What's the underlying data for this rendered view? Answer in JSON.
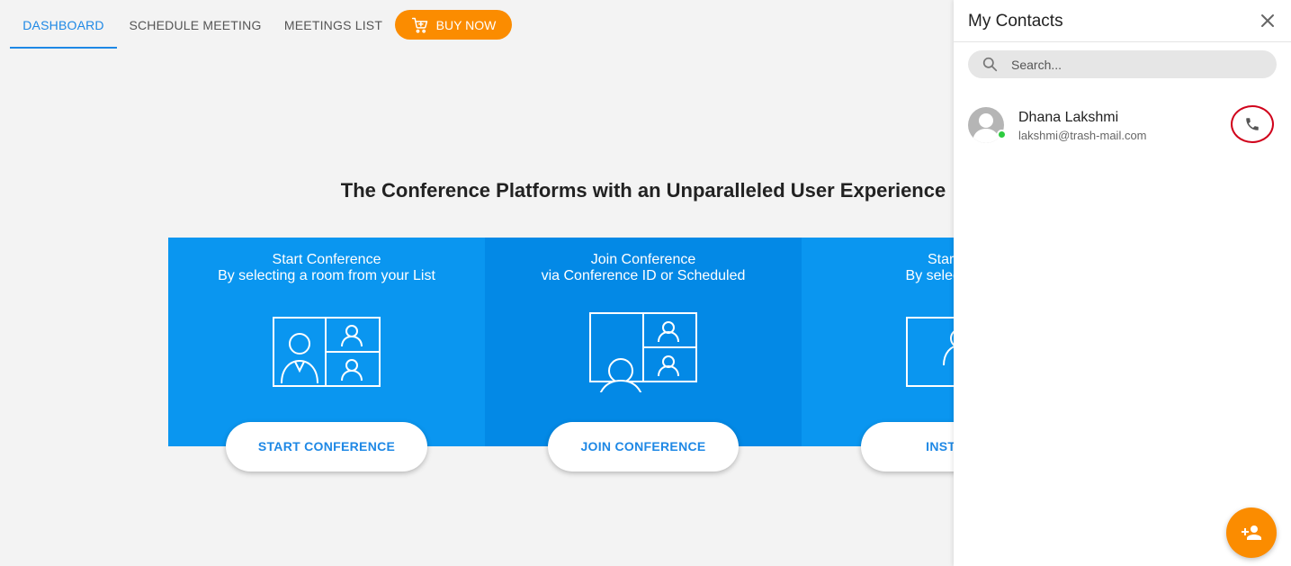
{
  "nav": {
    "tabs": [
      {
        "label": "DASHBOARD",
        "active": true
      },
      {
        "label": "SCHEDULE MEETING",
        "active": false
      },
      {
        "label": "MEETINGS LIST",
        "active": false
      }
    ],
    "buy_label": "BUY NOW",
    "buy_icon": "cart-icon"
  },
  "main": {
    "headline": "The Conference Platforms with an Unparalleled User Experience",
    "cards": [
      {
        "title_line1": "Start Conference",
        "title_line2": "By selecting a room from your List",
        "button": "START CONFERENCE"
      },
      {
        "title_line1": "Join Conference",
        "title_line2": "via Conference ID or Scheduled",
        "button": "JOIN CONFERENCE"
      },
      {
        "title_line1": "Start Conf",
        "title_line2": "By selecting a co",
        "button": "INSTA CO"
      }
    ]
  },
  "contacts": {
    "title": "My Contacts",
    "search_placeholder": "Search...",
    "items": [
      {
        "name": "Dhana Lakshmi",
        "email": "lakshmi@trash-mail.com",
        "status": "online"
      }
    ]
  },
  "colors": {
    "accent": "#1e88e5",
    "orange": "#fb8c00",
    "card_blue": "#0a96f0",
    "card_blue_dark": "#0389e6",
    "online": "#2ecc40",
    "call_ring": "#d0021b"
  }
}
